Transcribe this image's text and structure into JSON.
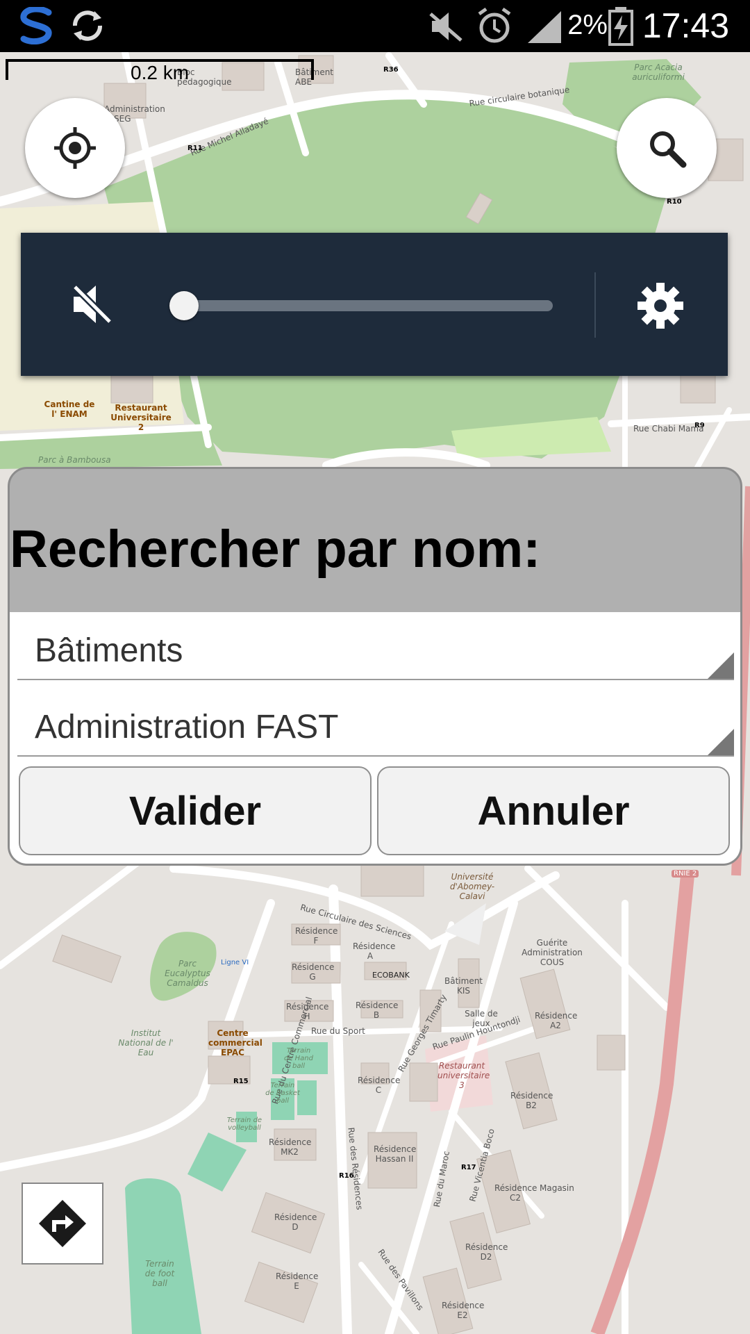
{
  "status_bar": {
    "battery_percent": "2%",
    "time": "17:43"
  },
  "map": {
    "scale_label": "0.2 km",
    "labels": [
      {
        "text": "Rue Michel Alladayé"
      },
      {
        "text": "Rue circulaire botanique"
      },
      {
        "text": "Parc Acacia auriculiformi"
      },
      {
        "text": "Bâtiment ABE"
      },
      {
        "text": "Bloc pédagogique"
      },
      {
        "text": "Administration FASEG"
      },
      {
        "text": "Cantine de l' ENAM"
      },
      {
        "text": "Restaurant Universitaire 2"
      },
      {
        "text": "Parc à Bambousa"
      },
      {
        "text": "Rue Chabi Mama"
      },
      {
        "text": "Rue Circulaire des Sciences"
      },
      {
        "text": "Parc Eucalyptus Camaldus"
      },
      {
        "text": "Institut National de l' Eau"
      },
      {
        "text": "Centre commercial EPAC"
      },
      {
        "text": "Rue du Centre Commercial"
      },
      {
        "text": "Rue du Sport"
      },
      {
        "text": "Résidence F"
      },
      {
        "text": "Résidence G"
      },
      {
        "text": "Résidence H"
      },
      {
        "text": "Résidence A"
      },
      {
        "text": "Résidence B"
      },
      {
        "text": "Résidence C"
      },
      {
        "text": "Résidence D"
      },
      {
        "text": "Résidence E"
      },
      {
        "text": "Résidence MK2"
      },
      {
        "text": "Résidence Hassan II"
      },
      {
        "text": "Résidence A2"
      },
      {
        "text": "Résidence B2"
      },
      {
        "text": "Résidence C2"
      },
      {
        "text": "Résidence D2"
      },
      {
        "text": "Résidence E2"
      },
      {
        "text": "Bâtiment KIS"
      },
      {
        "text": "Salle de jeux"
      },
      {
        "text": "ECOBANK"
      },
      {
        "text": "Restaurant universitaire 3"
      },
      {
        "text": "Rue Paulin Hountondji"
      },
      {
        "text": "Rue Georges Timarty"
      },
      {
        "text": "Rue des Résidences"
      },
      {
        "text": "Rue du Maroc"
      },
      {
        "text": "Rue Vicentia Boco"
      },
      {
        "text": "Rue des Pavillons"
      },
      {
        "text": "Université d'Abomey-Calavi"
      },
      {
        "text": "Guérite Administration COUS"
      },
      {
        "text": "Magasin"
      },
      {
        "text": "Terrain de Hand ball"
      },
      {
        "text": "Terrain de Basket ball"
      },
      {
        "text": "Terrain de volleyball"
      },
      {
        "text": "Terrain de foot ball"
      },
      {
        "text": "Ligne VI"
      },
      {
        "text": "R11"
      },
      {
        "text": "R36"
      },
      {
        "text": "R10"
      },
      {
        "text": "R9"
      },
      {
        "text": "R15"
      },
      {
        "text": "R16"
      },
      {
        "text": "R17"
      },
      {
        "text": "RNIE 2"
      }
    ]
  },
  "sound_panel": {
    "volume_level": 0.0,
    "mute_icon": "speaker-muted-icon",
    "settings_icon": "gear-icon"
  },
  "dialog": {
    "title": "Rechercher par nom:",
    "category_value": "Bâtiments",
    "name_value": "Administration FAST",
    "ok_label": "Valider",
    "cancel_label": "Annuler"
  },
  "colors": {
    "park": "#add19e",
    "road": "#ffffff",
    "building": "#d9d0c9",
    "dialog_header": "#b0b0b0",
    "panel": "#1e2b3b",
    "primary_road": "#e8a0a0"
  }
}
